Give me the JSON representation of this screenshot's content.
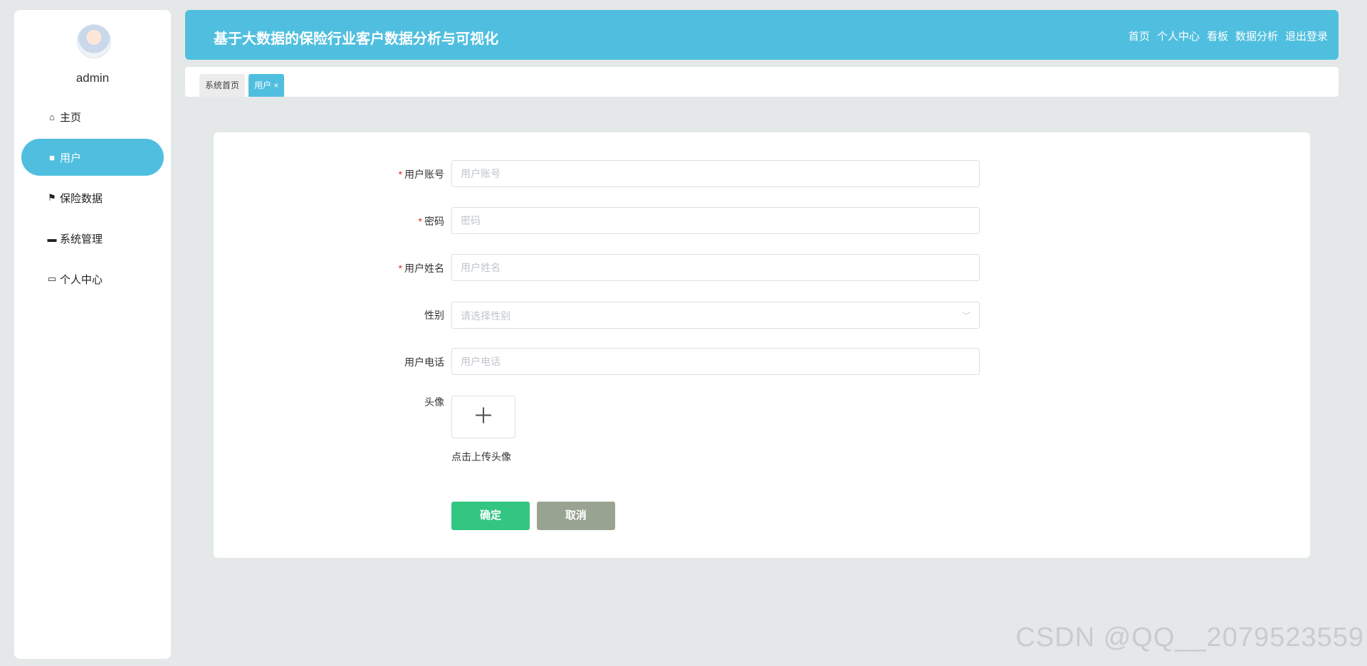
{
  "sidebar": {
    "username": "admin",
    "items": [
      {
        "icon": "home-icon",
        "glyph": "⌂",
        "label": "主页"
      },
      {
        "icon": "user-icon",
        "glyph": "■",
        "label": "用户"
      },
      {
        "icon": "flag-icon",
        "glyph": "⚑",
        "label": "保险数据"
      },
      {
        "icon": "chat-icon",
        "glyph": "▬",
        "label": "系统管理"
      },
      {
        "icon": "card-icon",
        "glyph": "▭",
        "label": "个人中心"
      }
    ]
  },
  "header": {
    "title": "基于大数据的保险行业客户数据分析与可视化",
    "nav": [
      "首页",
      "个人中心",
      "看板",
      "数据分析",
      "退出登录"
    ]
  },
  "tabs": [
    {
      "label": "系统首页"
    },
    {
      "label": "用户 ×"
    }
  ],
  "form": {
    "account": {
      "label": "用户账号",
      "placeholder": "用户账号"
    },
    "password": {
      "label": "密码",
      "placeholder": "密码"
    },
    "name": {
      "label": "用户姓名",
      "placeholder": "用户姓名"
    },
    "gender": {
      "label": "性别",
      "placeholder": "请选择性别"
    },
    "phone": {
      "label": "用户电话",
      "placeholder": "用户电话"
    },
    "avatar": {
      "label": "头像",
      "hint": "点击上传头像"
    },
    "required_mark": "*",
    "confirm": "确定",
    "cancel": "取消"
  },
  "watermark": "CSDN @QQ__2079523559"
}
